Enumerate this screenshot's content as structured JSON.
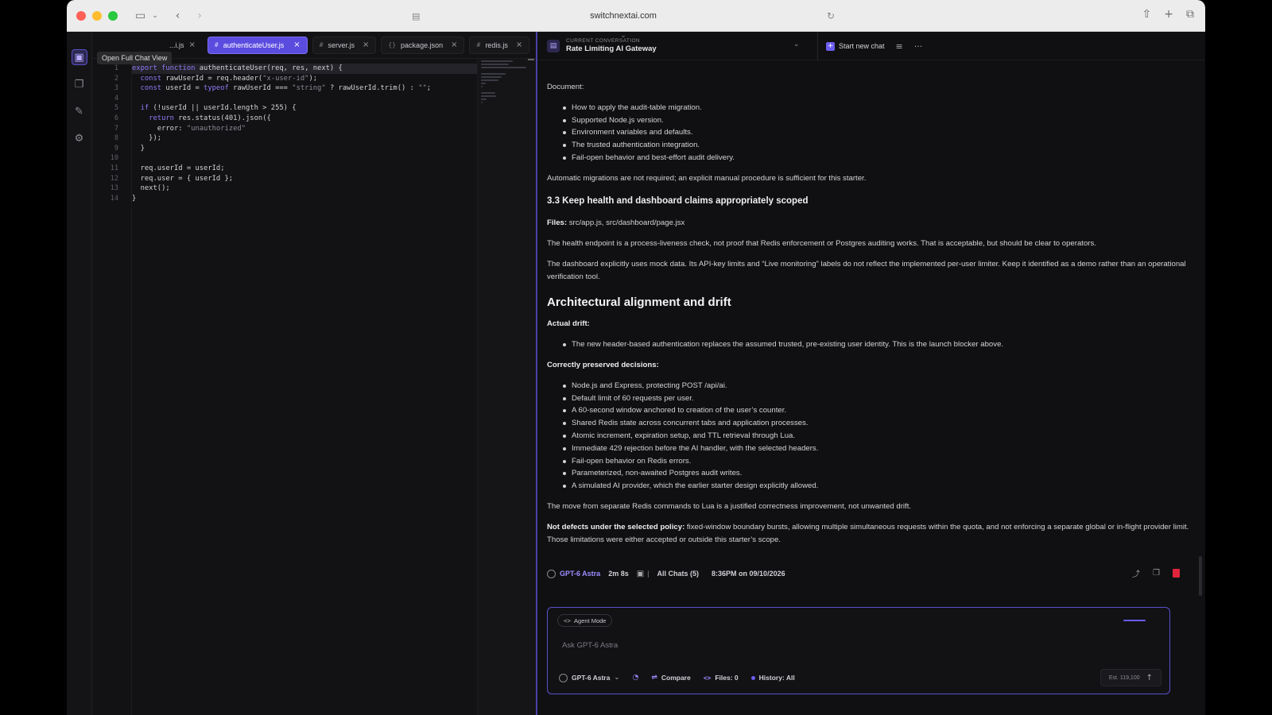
{
  "browser": {
    "url": "switchnextai.com",
    "icons": [
      "sidebar-icon",
      "chevron-down-icon",
      "back-icon",
      "forward-icon",
      "reader-icon",
      "reload-icon",
      "share-icon",
      "plus-icon",
      "tabs-icon"
    ]
  },
  "activity": {
    "tooltip": "Open Full Chat View",
    "icons": [
      "chat-view-icon",
      "files-icon",
      "edit-icon",
      "settings-icon"
    ]
  },
  "editor": {
    "tabs": [
      {
        "label": "...i.js",
        "icon": "js-icon"
      },
      {
        "label": "authenticateUser.js",
        "icon": "js-icon",
        "active": true
      },
      {
        "label": "server.js",
        "icon": "js-icon"
      },
      {
        "label": "package.json",
        "icon": "braces-icon"
      },
      {
        "label": "redis.js",
        "icon": "js-icon"
      }
    ],
    "line_numbers": [
      "1",
      "2",
      "3",
      "4",
      "5",
      "6",
      "7",
      "8",
      "9",
      "10",
      "11",
      "12",
      "13",
      "14"
    ],
    "code": [
      "export function authenticateUser(req, res, next) {",
      "  const rawUserId = req.header(\"x-user-id\");",
      "  const userId = typeof rawUserId === \"string\" ? rawUserId.trim() : \"\";",
      "",
      "  if (!userId || userId.length > 255) {",
      "    return res.status(401).json({",
      "      error: \"unauthorized\"",
      "    });",
      "  }",
      "",
      "  req.userId = userId;",
      "  req.user = { userId };",
      "  next();",
      "}"
    ]
  },
  "chat": {
    "header": {
      "label": "CURRENT CONVERSATION",
      "title": "Rate Limiting AI Gateway",
      "new_chat": "Start new chat"
    },
    "body": {
      "doc_label": "Document:",
      "doc_items": [
        "How to apply the audit-table migration.",
        "Supported Node.js version.",
        "Environment variables and defaults.",
        "The trusted authentication integration.",
        "Fail-open behavior and best-effort audit delivery."
      ],
      "migrations": "Automatic migrations are not required; an explicit manual procedure is sufficient for this starter.",
      "h3": "3.3 Keep health and dashboard claims appropriately scoped",
      "files_label": "Files:",
      "files_value": " src/app.js, src/dashboard/page.jsx",
      "health": "The health endpoint is a process-liveness check, not proof that Redis enforcement or Postgres auditing works. That is acceptable, but should be clear to operators.",
      "dashboard": "The dashboard explicitly uses mock data. Its API-key limits and “Live monitoring” labels do not reflect the implemented per-user limiter. Keep it identified as a demo rather than an operational verification tool.",
      "h2": "Architectural alignment and drift",
      "drift_label": "Actual drift:",
      "drift_items": [
        "The new header-based authentication replaces the assumed trusted, pre-existing user identity. This is the launch blocker above."
      ],
      "preserved_label": "Correctly preserved decisions:",
      "preserved_items": [
        "Node.js and Express, protecting POST /api/ai.",
        "Default limit of 60 requests per user.",
        "A 60-second window anchored to creation of the user’s counter.",
        "Shared Redis state across concurrent tabs and application processes.",
        "Atomic increment, expiration setup, and TTL retrieval through Lua.",
        "Immediate 429 rejection before the AI handler, with the selected headers.",
        "Fail-open behavior on Redis errors.",
        "Parameterized, non-awaited Postgres audit writes.",
        "A simulated AI provider, which the earlier starter design explicitly allowed."
      ],
      "lua": "The move from separate Redis commands to Lua is a justified correctness improvement, not unwanted drift.",
      "not_defects_label": "Not defects under the selected policy:",
      "not_defects_value": " fixed-window boundary bursts, allowing multiple simultaneous requests within the quota, and not enforcing a separate global or in-flight provider limit. Those limitations were either accepted or outside this starter’s scope."
    },
    "meta": {
      "model": "GPT-6 Astra",
      "duration": "2m 8s",
      "separator": "|",
      "all_chats": "All Chats (5)",
      "timestamp": "8:36PM on 09/10/2026"
    },
    "composer": {
      "mode": "Agent Mode",
      "placeholder": "Ask GPT-6 Astra",
      "model": "GPT-6 Astra",
      "compare": "Compare",
      "files": "Files: 0",
      "history": "History: All",
      "estimate": "Est. 119,100"
    }
  },
  "colors": {
    "accent": "#6b5cf0",
    "active_tab": "#5b4ce0",
    "delete": "#e0243b"
  }
}
